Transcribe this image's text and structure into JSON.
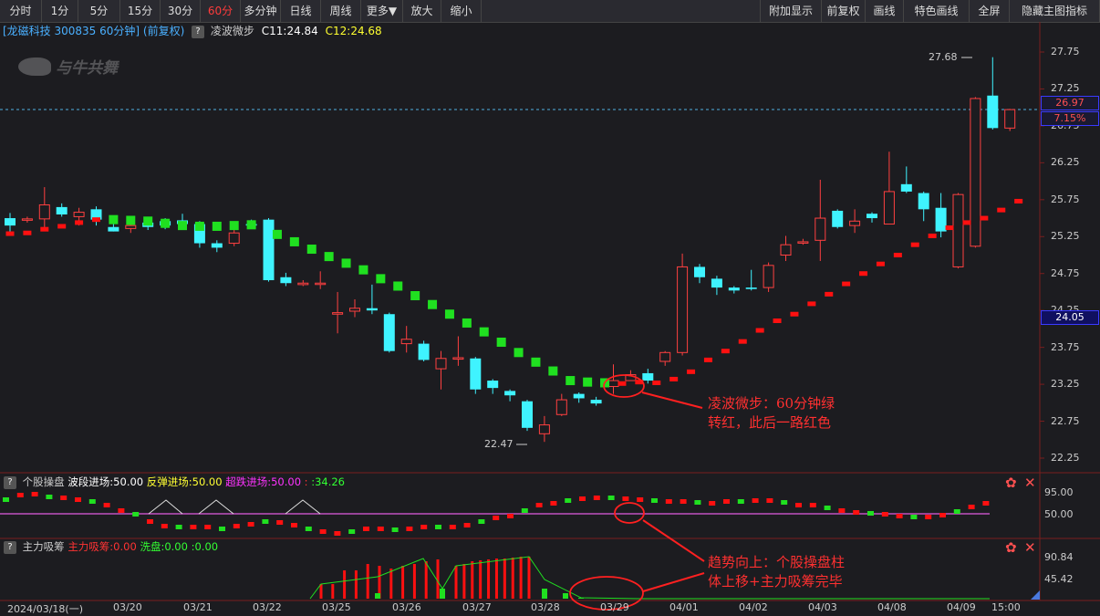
{
  "toolbar": {
    "left": [
      "分时",
      "1分",
      "5分",
      "15分",
      "30分",
      "60分",
      "多分钟",
      "日线",
      "周线",
      "更多▼",
      "放大",
      "缩小"
    ],
    "active": "60分",
    "right": [
      "附加显示",
      "前复权",
      "画线",
      "特色画线",
      "全屏",
      "隐藏主图指标"
    ]
  },
  "info": {
    "title": "[龙磁科技 300835 60分钟] (前复权)",
    "indicator": "凌波微步",
    "c1": "C11:24.84",
    "c2": "C12:24.68",
    "watermark": "与牛共舞"
  },
  "price_axis": {
    "ticks": [
      "27.75",
      "27.25",
      "26.75",
      "26.25",
      "25.75",
      "25.25",
      "24.75",
      "24.25",
      "23.75",
      "23.25",
      "22.75",
      "22.25"
    ],
    "current_price": "26.97",
    "change_pct": "7.15%",
    "crosshair": "24.05",
    "high_label": "27.68",
    "low_label": "22.47",
    "current_color": "#3a3aff"
  },
  "sub1": {
    "name": "个股操盘",
    "items": [
      {
        "label": "波段进场:50.00",
        "color": "#ffffff"
      },
      {
        "label": "反弹进场:50.00",
        "color": "#ffff33"
      },
      {
        "label": "超跌进场:50.00",
        "color": "#ff33ff"
      },
      {
        "label": ":",
        "color": "#ff3333"
      },
      {
        "label": ":34.26",
        "color": "#33ff33"
      }
    ],
    "ticks": [
      "95.00",
      "50.00"
    ]
  },
  "sub2": {
    "name": "主力吸筹",
    "items": [
      {
        "label": "主力吸筹:0.00",
        "color": "#ff3333"
      },
      {
        "label": "洗盘:0.00",
        "color": "#33ff33"
      },
      {
        "label": ":0.00",
        "color": "#33ff33"
      }
    ],
    "ticks": [
      "90.84",
      "45.42"
    ]
  },
  "dates": [
    "2024/03/18(一)",
    "03/20",
    "03/21",
    "03/22",
    "03/25",
    "03/26",
    "03/27",
    "03/28",
    "03/29",
    "04/01",
    "04/02",
    "04/03",
    "04/08",
    "04/09",
    "15:00"
  ],
  "annotations": {
    "a1": [
      "凌波微步：60分钟绿",
      "转红，此后一路红色"
    ],
    "a2": [
      "趋势向上：个股操盘柱",
      "体上移+主力吸筹完毕"
    ]
  },
  "colors": {
    "up": "#ff4040",
    "down": "#3ff3ff",
    "ind_red": "#ff1010",
    "ind_green": "#20e020",
    "grid": "#5a1a1a"
  },
  "chart_data": {
    "type": "candlestick",
    "series": [
      {
        "values": [
          [
            25.5,
            25.4,
            25.57,
            25.27
          ],
          [
            25.48,
            25.49,
            25.52,
            25.44
          ],
          [
            25.49,
            25.68,
            25.92,
            25.34
          ],
          [
            25.65,
            25.55,
            25.7,
            25.52
          ],
          [
            25.52,
            25.58,
            25.64,
            25.4
          ],
          [
            25.62,
            25.48,
            25.66,
            25.4
          ],
          [
            25.38,
            25.32,
            25.52,
            25.32
          ],
          [
            25.36,
            25.4,
            25.46,
            25.3
          ],
          [
            25.44,
            25.38,
            25.5,
            25.34
          ],
          [
            25.46,
            25.4,
            25.5,
            25.35
          ],
          [
            25.47,
            25.42,
            25.56,
            25.36
          ],
          [
            25.42,
            25.16,
            25.46,
            25.1
          ],
          [
            25.16,
            25.1,
            25.2,
            25.04
          ],
          [
            25.16,
            25.3,
            25.42,
            25.12
          ],
          [
            25.42,
            25.4,
            25.48,
            25.36
          ],
          [
            25.48,
            24.66,
            25.5,
            24.64
          ],
          [
            24.7,
            24.62,
            24.76,
            24.58
          ],
          [
            24.6,
            24.62,
            24.66,
            24.58
          ],
          [
            24.62,
            24.62,
            24.78,
            24.54
          ],
          [
            24.2,
            24.22,
            24.5,
            23.94
          ],
          [
            24.24,
            24.28,
            24.4,
            24.16
          ],
          [
            24.28,
            24.25,
            24.6,
            24.2
          ],
          [
            24.2,
            23.7,
            24.22,
            23.68
          ],
          [
            23.8,
            23.86,
            24.04,
            23.68
          ],
          [
            23.8,
            23.58,
            23.84,
            23.56
          ],
          [
            23.46,
            23.6,
            23.7,
            23.18
          ],
          [
            23.59,
            23.61,
            23.9,
            23.5
          ],
          [
            23.6,
            23.18,
            23.62,
            23.12
          ],
          [
            23.3,
            23.2,
            23.32,
            23.12
          ],
          [
            23.16,
            23.1,
            23.18,
            23.02
          ],
          [
            23.02,
            22.66,
            23.04,
            22.62
          ],
          [
            22.58,
            22.7,
            22.82,
            22.47
          ],
          [
            22.84,
            23.04,
            23.12,
            22.82
          ],
          [
            23.12,
            23.06,
            23.14,
            23.0
          ],
          [
            23.04,
            22.99,
            23.08,
            22.96
          ],
          [
            23.22,
            23.3,
            23.52,
            23.12
          ],
          [
            23.3,
            23.38,
            23.44,
            23.32
          ],
          [
            23.4,
            23.3,
            23.46,
            23.26
          ],
          [
            23.56,
            23.68,
            23.7,
            23.5
          ],
          [
            23.68,
            24.84,
            25.02,
            23.64
          ],
          [
            24.84,
            24.7,
            24.88,
            24.62
          ],
          [
            24.68,
            24.56,
            24.72,
            24.46
          ],
          [
            24.56,
            24.52,
            24.58,
            24.48
          ],
          [
            24.56,
            24.54,
            24.8,
            24.52
          ],
          [
            24.56,
            24.86,
            24.9,
            24.5
          ],
          [
            25.0,
            25.14,
            25.26,
            24.92
          ],
          [
            25.18,
            25.18,
            25.22,
            25.14
          ],
          [
            25.2,
            25.5,
            26.02,
            24.92
          ],
          [
            25.6,
            25.38,
            25.62,
            25.36
          ],
          [
            25.4,
            25.46,
            25.62,
            25.3
          ],
          [
            25.56,
            25.5,
            25.58,
            25.44
          ],
          [
            25.42,
            25.86,
            26.4,
            25.42
          ],
          [
            25.96,
            25.86,
            26.2,
            25.84
          ],
          [
            25.84,
            25.62,
            25.86,
            25.46
          ],
          [
            25.64,
            25.32,
            25.84,
            25.24
          ],
          [
            24.84,
            25.82,
            25.84,
            24.82
          ],
          [
            25.12,
            27.12,
            27.14,
            25.1
          ],
          [
            27.16,
            26.72,
            27.68,
            26.7
          ],
          [
            26.72,
            26.97,
            26.98,
            26.68
          ]
        ]
      },
      {
        "name": "凌波微步",
        "values": [
          [
            0.0,
            25.29,
            "r"
          ],
          [
            1.0,
            25.3,
            "r"
          ],
          [
            2.0,
            25.35,
            "r"
          ],
          [
            3.0,
            25.39,
            "r"
          ],
          [
            4.0,
            25.44,
            "r"
          ],
          [
            5.0,
            25.48,
            "r"
          ],
          [
            6.0,
            25.48,
            "g"
          ],
          [
            7.0,
            25.47,
            "g"
          ],
          [
            8.0,
            25.46,
            "g"
          ],
          [
            9.0,
            25.43,
            "g"
          ],
          [
            10.0,
            25.4,
            "g"
          ],
          [
            11.0,
            25.39,
            "g"
          ],
          [
            12.0,
            25.39,
            "g"
          ],
          [
            13.0,
            25.4,
            "g"
          ],
          [
            14.0,
            25.41,
            "g"
          ],
          [
            15.5,
            25.28,
            "g"
          ],
          [
            16.5,
            25.18,
            "g"
          ],
          [
            17.5,
            25.08,
            "g"
          ],
          [
            18.5,
            24.98,
            "g"
          ],
          [
            19.5,
            24.89,
            "g"
          ],
          [
            20.5,
            24.8,
            "g"
          ],
          [
            21.5,
            24.68,
            "g"
          ],
          [
            22.5,
            24.58,
            "g"
          ],
          [
            23.5,
            24.45,
            "g"
          ],
          [
            24.5,
            24.33,
            "g"
          ],
          [
            25.5,
            24.2,
            "g"
          ],
          [
            26.5,
            24.08,
            "g"
          ],
          [
            27.5,
            23.96,
            "g"
          ],
          [
            28.5,
            23.82,
            "g"
          ],
          [
            29.5,
            23.68,
            "g"
          ],
          [
            30.5,
            23.55,
            "g"
          ],
          [
            31.5,
            23.43,
            "g"
          ],
          [
            32.5,
            23.3,
            "g"
          ],
          [
            33.5,
            23.28,
            "g"
          ],
          [
            34.5,
            23.27,
            "g"
          ],
          [
            35.5,
            23.26,
            "r"
          ],
          [
            36.5,
            23.28,
            "r"
          ],
          [
            37.5,
            23.27,
            "r"
          ],
          [
            38.5,
            23.32,
            "r"
          ],
          [
            39.5,
            23.42,
            "r"
          ],
          [
            40.5,
            23.58,
            "r"
          ],
          [
            41.5,
            23.7,
            "r"
          ],
          [
            42.5,
            23.83,
            "r"
          ],
          [
            43.5,
            23.98,
            "r"
          ],
          [
            44.5,
            24.11,
            "r"
          ],
          [
            45.5,
            24.2,
            "r"
          ],
          [
            46.5,
            24.34,
            "r"
          ],
          [
            47.5,
            24.47,
            "r"
          ],
          [
            48.5,
            24.61,
            "r"
          ],
          [
            49.5,
            24.75,
            "r"
          ],
          [
            50.5,
            24.88,
            "r"
          ],
          [
            51.5,
            25.0,
            "r"
          ],
          [
            52.5,
            25.14,
            "r"
          ],
          [
            53.5,
            25.26,
            "r"
          ],
          [
            54.5,
            25.37,
            "r"
          ],
          [
            55.5,
            25.44,
            "r"
          ],
          [
            56.5,
            25.5,
            "r"
          ],
          [
            57.5,
            25.61,
            "r"
          ],
          [
            58.5,
            25.73,
            "r"
          ]
        ]
      }
    ],
    "ylim": [
      22.25,
      27.75
    ]
  }
}
